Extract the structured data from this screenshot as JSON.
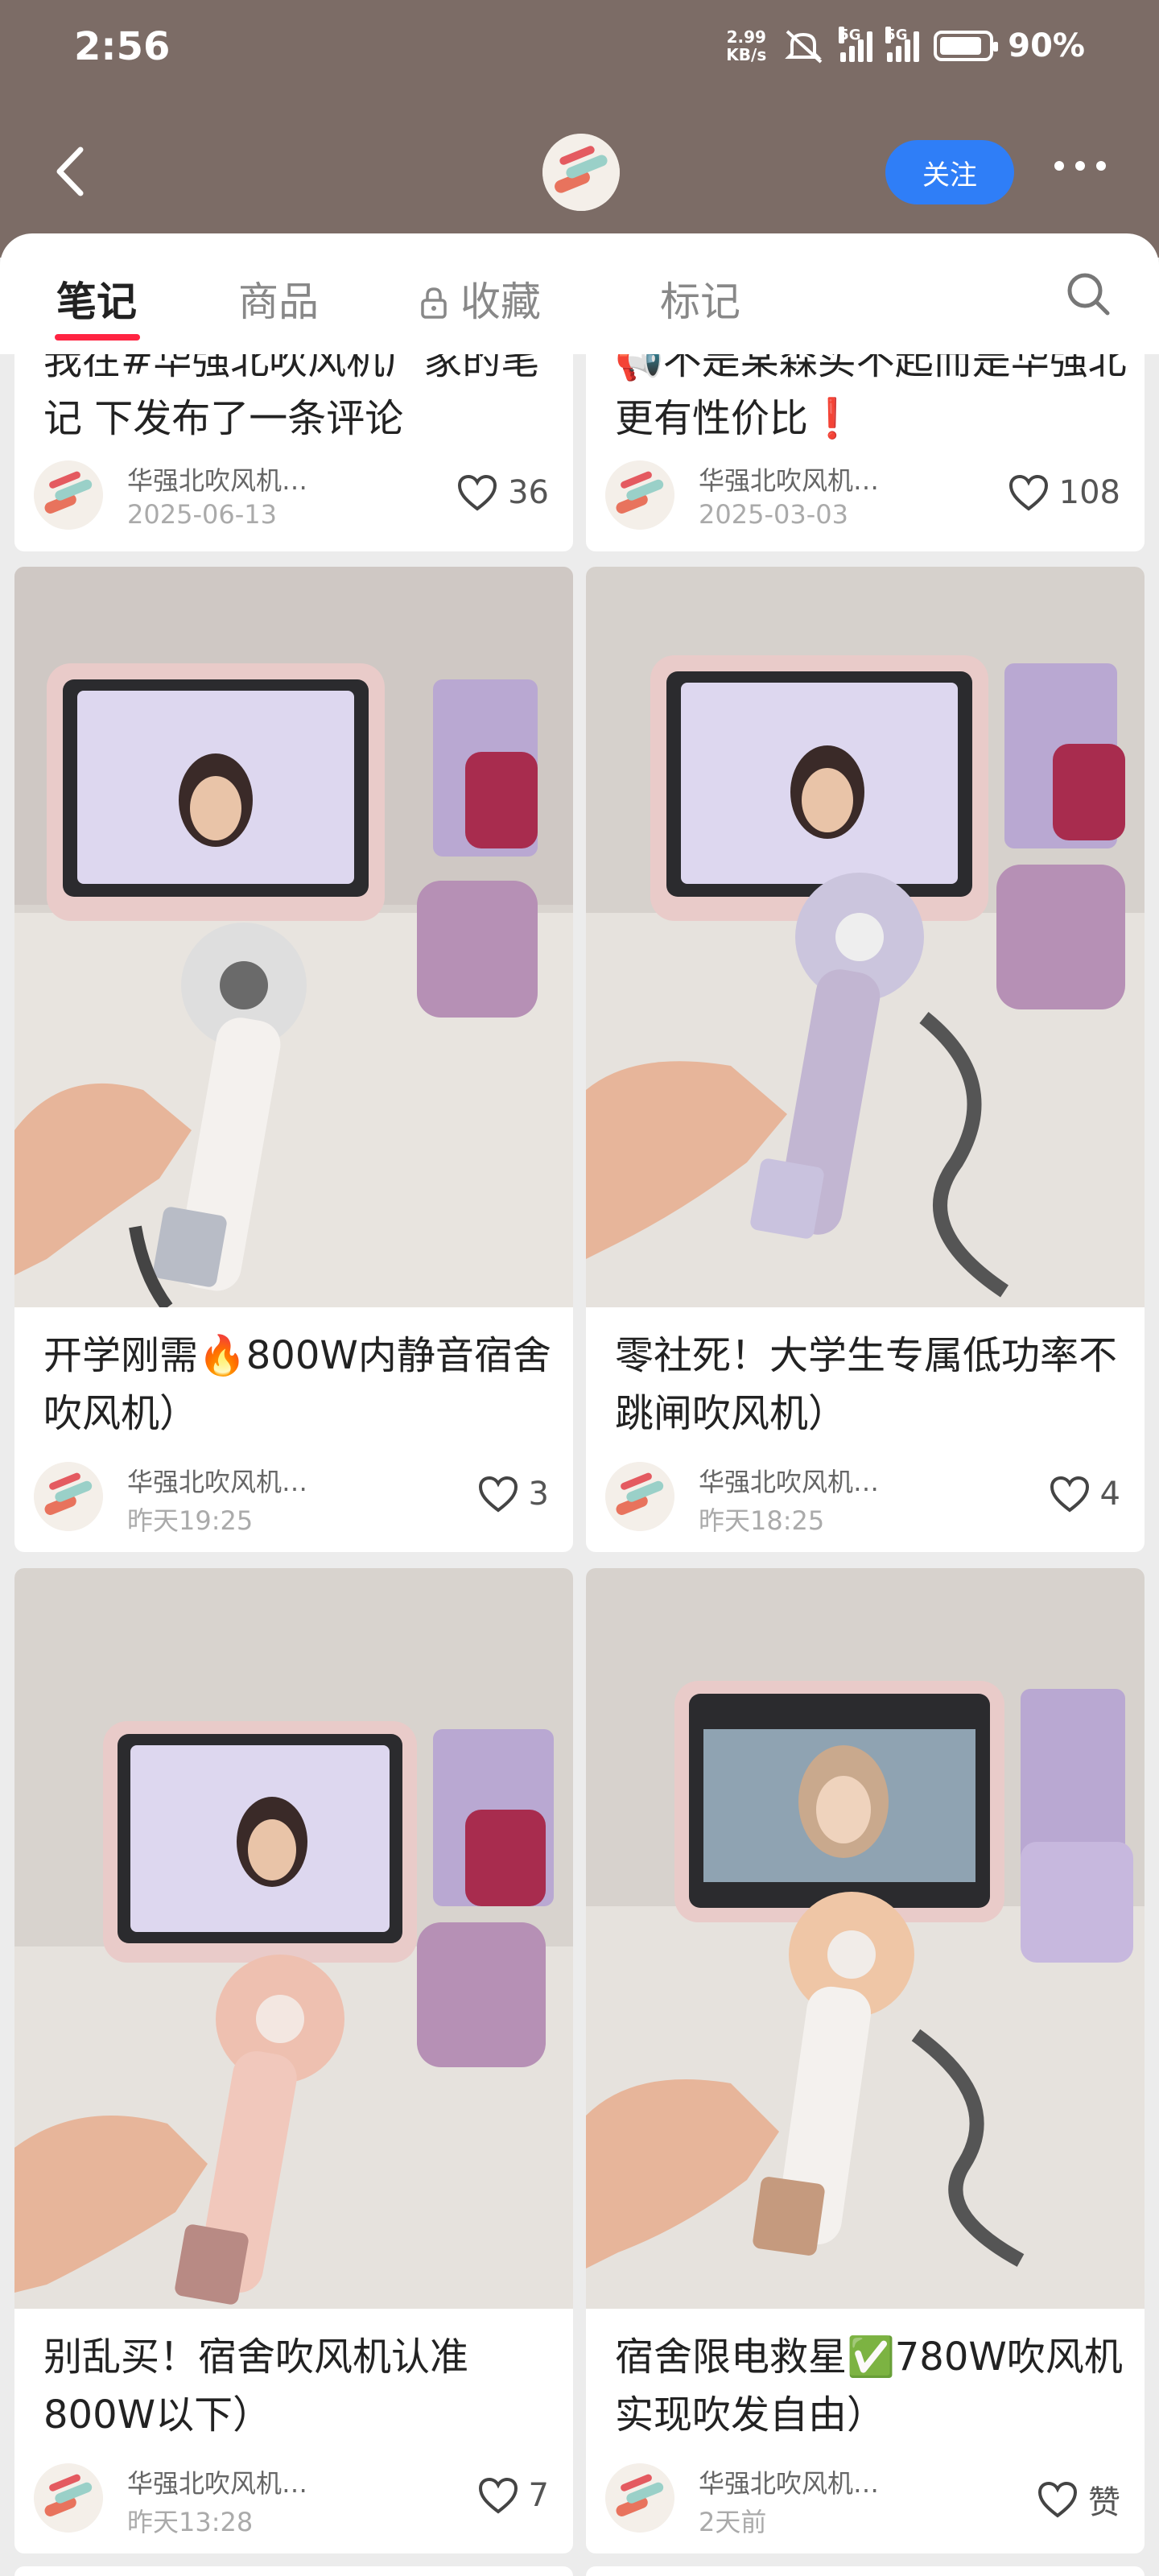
{
  "status_bar": {
    "time": "2:56",
    "net_speed_top": "2.99",
    "net_speed_unit": "KB/s",
    "sig1": "5G",
    "sig2": "5G",
    "battery": "90%"
  },
  "header": {
    "follow_label": "关注"
  },
  "tabs": [
    {
      "label": "笔记",
      "active": true
    },
    {
      "label": "商品",
      "active": false
    },
    {
      "label": "收藏",
      "active": false
    },
    {
      "label": "标记",
      "active": false
    }
  ],
  "notes": [
    {
      "title": "我在#华强北吹风机厂家的笔记 下发布了一条评论",
      "author": "华强北吹风机…",
      "date": "2025-06-13",
      "likes": "36"
    },
    {
      "title": "📢不是某森买不起而是华强北更有性价比❗",
      "author": "华强北吹风机…",
      "date": "2025-03-03",
      "likes": "108"
    },
    {
      "title": "开学刚需🔥800W内静音宿舍吹风机）",
      "author": "华强北吹风机…",
      "date": "昨天19:25",
      "likes": "3"
    },
    {
      "title": "零社死！大学生专属低功率不跳闸吹风机）",
      "author": "华强北吹风机…",
      "date": "昨天18:25",
      "likes": "4"
    },
    {
      "title": "别乱买！宿舍吹风机认准800W以下）",
      "author": "华强北吹风机…",
      "date": "昨天13:28",
      "likes": "7"
    },
    {
      "title": "宿舍限电救星✅780W吹风机实现吹发自由）",
      "author": "华强北吹风机…",
      "date": "2天前",
      "likes": "赞"
    }
  ],
  "colors": {
    "accent": "#ff2442",
    "follow_button": "#2f7ef7",
    "header_bg": "#7c6c66"
  }
}
